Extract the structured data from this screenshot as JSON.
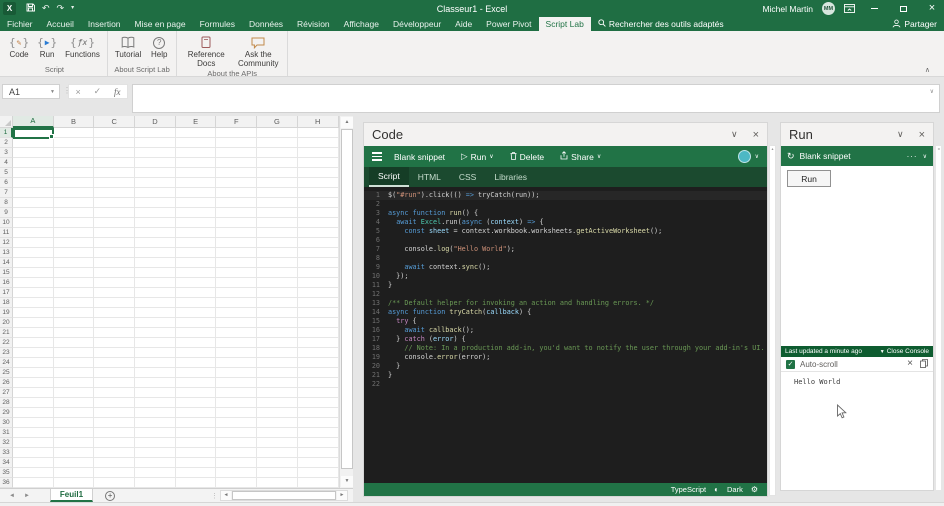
{
  "titlebar": {
    "title": "Classeur1 - Excel",
    "user_name": "Michel Martin",
    "avatar_initials": "MM"
  },
  "ribbon": {
    "tabs": [
      "Fichier",
      "Accueil",
      "Insertion",
      "Mise en page",
      "Formules",
      "Données",
      "Révision",
      "Affichage",
      "Développeur",
      "Aide",
      "Power Pivot",
      "Script Lab"
    ],
    "selected_tab": "Script Lab",
    "search_label": "Rechercher des outils adaptés",
    "share_label": "Partager",
    "groups": [
      {
        "label": "Script",
        "buttons": [
          {
            "label": "Code"
          },
          {
            "label": "Run"
          },
          {
            "label": "Functions"
          }
        ]
      },
      {
        "label": "About Script Lab",
        "buttons": [
          {
            "label": "Tutorial"
          },
          {
            "label": "Help"
          }
        ]
      },
      {
        "label": "About the APIs",
        "buttons": [
          {
            "label": "Reference Docs"
          },
          {
            "label": "Ask the Community"
          }
        ]
      }
    ]
  },
  "formula_bar": {
    "name_box": "A1",
    "fx_label": "fx"
  },
  "grid": {
    "columns": [
      "A",
      "B",
      "C",
      "D",
      "E",
      "F",
      "G",
      "H"
    ],
    "row_count": 36,
    "selected": "A1"
  },
  "sheet_bar": {
    "tabs": [
      {
        "label": "Feuil1",
        "active": true
      }
    ]
  },
  "code_pane": {
    "title": "Code",
    "snippet_name": "Blank snippet",
    "run_label": "Run",
    "delete_label": "Delete",
    "share_label": "Share",
    "tabs": [
      "Script",
      "HTML",
      "CSS",
      "Libraries"
    ],
    "selected_tab": "Script",
    "status": {
      "language": "TypeScript",
      "theme_label": "Dark"
    }
  },
  "editor": {
    "lines": [
      {
        "n": 1,
        "t": [
          [
            "p",
            "$("
          ],
          [
            "s",
            "\"#run\""
          ],
          [
            "p",
            ").click(() "
          ],
          [
            "k",
            "=>"
          ],
          [
            "p",
            " tryCatch(run));"
          ]
        ]
      },
      {
        "n": 2,
        "t": []
      },
      {
        "n": 3,
        "t": [
          [
            "k",
            "async"
          ],
          [
            "p",
            " "
          ],
          [
            "k",
            "function"
          ],
          [
            "p",
            " "
          ],
          [
            "f",
            "run"
          ],
          [
            "p",
            "() {"
          ]
        ]
      },
      {
        "n": 4,
        "t": [
          [
            "p",
            "  "
          ],
          [
            "k",
            "await"
          ],
          [
            "p",
            " "
          ],
          [
            "ty",
            "Excel"
          ],
          [
            "p",
            ".run("
          ],
          [
            "k",
            "async"
          ],
          [
            "p",
            " ("
          ],
          [
            "v",
            "context"
          ],
          [
            "p",
            ") "
          ],
          [
            "k",
            "=>"
          ],
          [
            "p",
            " {"
          ]
        ]
      },
      {
        "n": 5,
        "t": [
          [
            "p",
            "    "
          ],
          [
            "k",
            "const"
          ],
          [
            "p",
            " "
          ],
          [
            "v",
            "sheet"
          ],
          [
            "p",
            " = context.workbook.worksheets."
          ],
          [
            "f",
            "getActiveWorksheet"
          ],
          [
            "p",
            "();"
          ]
        ]
      },
      {
        "n": 6,
        "t": []
      },
      {
        "n": 7,
        "t": [
          [
            "p",
            "    console."
          ],
          [
            "f",
            "log"
          ],
          [
            "p",
            "("
          ],
          [
            "s",
            "\"Hello World\""
          ],
          [
            "p",
            ");"
          ]
        ]
      },
      {
        "n": 8,
        "t": []
      },
      {
        "n": 9,
        "t": [
          [
            "p",
            "    "
          ],
          [
            "k",
            "await"
          ],
          [
            "p",
            " context."
          ],
          [
            "f",
            "sync"
          ],
          [
            "p",
            "();"
          ]
        ]
      },
      {
        "n": 10,
        "t": [
          [
            "p",
            "  });"
          ]
        ]
      },
      {
        "n": 11,
        "t": [
          [
            "p",
            "}"
          ]
        ]
      },
      {
        "n": 12,
        "t": []
      },
      {
        "n": 13,
        "t": [
          [
            "c",
            "/** Default helper for invoking an action and handling errors. */"
          ]
        ]
      },
      {
        "n": 14,
        "t": [
          [
            "k",
            "async"
          ],
          [
            "p",
            " "
          ],
          [
            "k",
            "function"
          ],
          [
            "p",
            " "
          ],
          [
            "f",
            "tryCatch"
          ],
          [
            "p",
            "("
          ],
          [
            "v",
            "callback"
          ],
          [
            "p",
            ") {"
          ]
        ]
      },
      {
        "n": 15,
        "t": [
          [
            "p",
            "  "
          ],
          [
            "ct",
            "try"
          ],
          [
            "p",
            " {"
          ]
        ]
      },
      {
        "n": 16,
        "t": [
          [
            "p",
            "    "
          ],
          [
            "k",
            "await"
          ],
          [
            "p",
            " "
          ],
          [
            "f",
            "callback"
          ],
          [
            "p",
            "();"
          ]
        ]
      },
      {
        "n": 17,
        "t": [
          [
            "p",
            "  } "
          ],
          [
            "ct",
            "catch"
          ],
          [
            "p",
            " ("
          ],
          [
            "v",
            "error"
          ],
          [
            "p",
            ") {"
          ]
        ]
      },
      {
        "n": 18,
        "t": [
          [
            "c",
            "    // Note: In a production add-in, you'd want to notify the user through your add-in's UI."
          ]
        ]
      },
      {
        "n": 19,
        "t": [
          [
            "p",
            "    console."
          ],
          [
            "f",
            "error"
          ],
          [
            "p",
            "(error);"
          ]
        ]
      },
      {
        "n": 20,
        "t": [
          [
            "p",
            "  }"
          ]
        ]
      },
      {
        "n": 21,
        "t": [
          [
            "p",
            "}"
          ]
        ]
      },
      {
        "n": 22,
        "t": []
      }
    ]
  },
  "run_pane": {
    "title": "Run",
    "snippet_name": "Blank snippet",
    "run_button_label": "Run",
    "console": {
      "last_updated": "Last updated a minute ago",
      "close_label": "Close Console",
      "autoscroll_label": "Auto-scroll",
      "output_lines": [
        "Hello World"
      ]
    }
  },
  "colors": {
    "accent": "#217346",
    "titlebar": "#1f6e43",
    "editor_bg": "#1e1e1e"
  }
}
